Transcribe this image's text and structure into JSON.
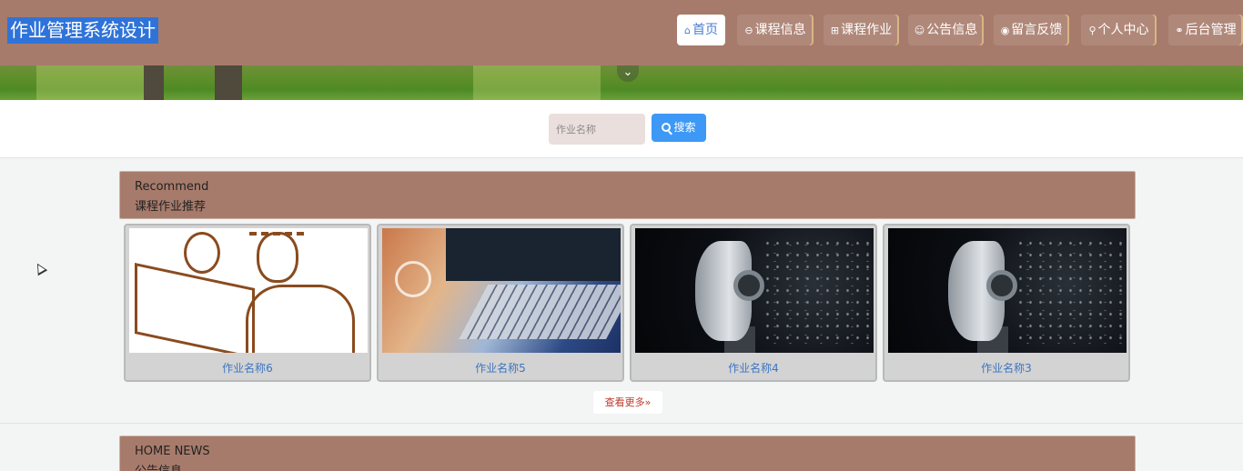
{
  "header": {
    "title": "作业管理系统设计",
    "nav": [
      {
        "icon": "home-icon",
        "glyph": "⌂",
        "label": "首页",
        "active": true
      },
      {
        "icon": "course-icon",
        "glyph": "⊖",
        "label": "课程信息",
        "active": false
      },
      {
        "icon": "homework-icon",
        "glyph": "⊞",
        "label": "课程作业",
        "active": false
      },
      {
        "icon": "notice-icon",
        "glyph": "☺",
        "label": "公告信息",
        "active": false
      },
      {
        "icon": "message-icon",
        "glyph": "◉",
        "label": "留言反馈",
        "active": false
      },
      {
        "icon": "user-icon",
        "glyph": "⚲",
        "label": "个人中心",
        "active": false
      },
      {
        "icon": "link-icon",
        "glyph": "⚭",
        "label": "后台管理",
        "active": false
      }
    ]
  },
  "banner": {
    "toggle_icon": "chevron-down-icon",
    "toggle_glyph": "⌄"
  },
  "search": {
    "placeholder": "作业名称",
    "value": "",
    "button_label": "搜索",
    "button_icon": "search-icon"
  },
  "recommend": {
    "title_en": "Recommend",
    "title_cn": "课程作业推荐",
    "items": [
      {
        "name": "作业名称6",
        "image": "sketch-illustration"
      },
      {
        "name": "作业名称5",
        "image": "laptop-photo"
      },
      {
        "name": "作业名称4",
        "image": "robot-photo"
      },
      {
        "name": "作业名称3",
        "image": "robot-photo"
      }
    ],
    "more_label": "查看更多",
    "more_icon": "double-chevron-right-icon",
    "more_glyph": "»"
  },
  "news": {
    "title_en": "HOME NEWS",
    "title_cn": "公告信息"
  },
  "colors": {
    "header_bg": "#a77b6b",
    "accent_blue": "#3d99f5",
    "link_blue": "#3e75c2",
    "card_bg": "#d3d3d3"
  }
}
